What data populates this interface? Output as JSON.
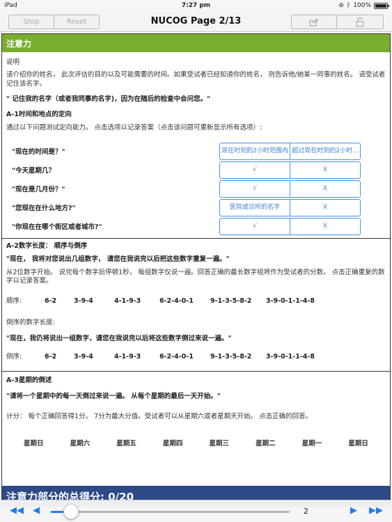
{
  "status_bar": {
    "device": "iPad",
    "time": "7:27 pm",
    "battery": "100%",
    "battery_level": 1.0
  },
  "nav": {
    "stop": "Stop",
    "reset": "Reset",
    "title": "NUCOG Page 2/13"
  },
  "section": {
    "header": "注意力",
    "instructions_label": "说明",
    "intro": "请介绍你的姓名， 此次评估的目的以及可能需要的时间。如果受试者已经知道你的姓名， 则告诉他/她某一同事的姓名。 请受试者记住该名字。",
    "remember": "\" 记住我的名字（或者我同事的名字)，因为在随后的检查中会问您。\""
  },
  "a1": {
    "title": "A-1时间和地点的定向",
    "desc": "通过以下问题测试定向能力。 点击选项以记录答案（点击该问题可重新显示所有选项）:",
    "rows": [
      {
        "q": "\"现在的时间是？\"",
        "c1": "现在时刻的2小时范围内",
        "c2": "超过现在时刻的2小时..."
      },
      {
        "q": "\"今天星期几？",
        "c1": "√",
        "c2": "X"
      },
      {
        "q": "\"现在是几月份？\"",
        "c1": "√",
        "c2": "X"
      },
      {
        "q": "\"您现在在什么地方?\"",
        "c1": "医院或诊所的名字",
        "c2": "X"
      },
      {
        "q": "\"你现在在哪个街区或者城市?\"",
        "c1": "√",
        "c2": "X"
      }
    ]
  },
  "a2": {
    "title": "A-2数字长度： 顺序与倒序",
    "instr1": "\"现在， 我将对您说出几组数字， 请您在我说完以后把这些数字重复一遍。\"",
    "desc": "从2位数字开始。 说完每个数字后停顿1秒， 每组数字仅说一遍。回答正确的最长数字组将作为受试者的分数。 点击正确重复的数字以记录答案。",
    "forward_label": "顺序:",
    "forward": [
      "6-2",
      "3-9-4",
      "4-1-9-3",
      "6-2-4-0-1",
      "9-1-3-5-8-2",
      "3-9-0-1-1-4-8"
    ],
    "backward_title": "倒序的数字长度:",
    "instr2": "\"现在，我仍将说出一组数字，请您在我说完以后将这些数字倒过来说一遍。\"",
    "backward_label": "倒序:",
    "backward": [
      "6-2",
      "3-9-4",
      "4-1-9-3",
      "6-2-4-0-1",
      "9-1-3-5-8-2",
      "3-9-0-1-1-4-8"
    ]
  },
  "a3": {
    "title": "A-3星期的倒述",
    "instr": "\"请将一个星期中的每一天倒过来说一遍。 从每个星期的最后一天开始。\"",
    "desc": "计分： 每个正确回答得1分。 7分为最大分值。受试者可以从星期六或者星期天开始。 点击正确的回答。",
    "days": [
      "星期日",
      "星期六",
      "星期五",
      "星期四",
      "星期三",
      "星期二",
      "星期一",
      "星期日"
    ]
  },
  "score": "注意力部分的总得分: 0/20",
  "toolbar": {
    "page_number": "2",
    "slider_value": 2,
    "slider_max": 13
  },
  "colors": {
    "section_header": "#7aae2e",
    "score_bar": "#2e4a86",
    "accent": "#1f7cf2",
    "cell_border": "#4a90e2"
  }
}
